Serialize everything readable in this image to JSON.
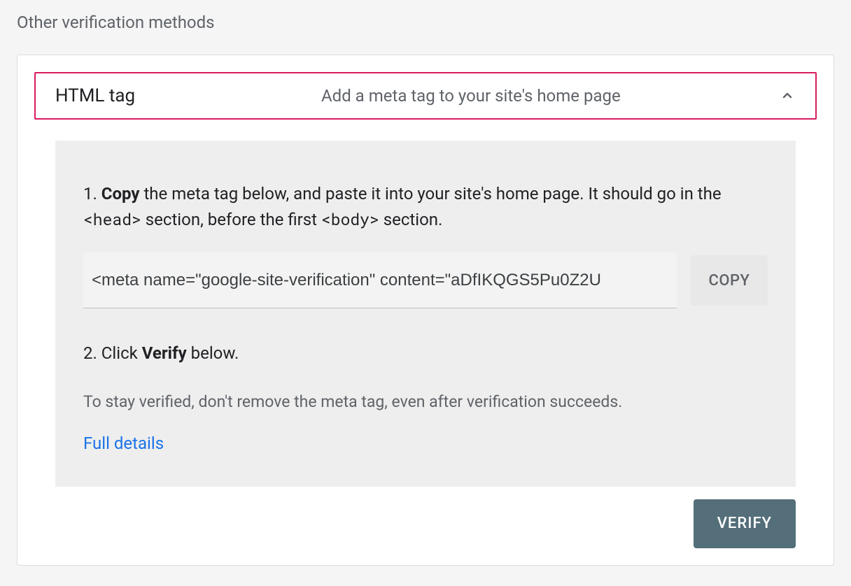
{
  "section_title": "Other verification methods",
  "method": {
    "title": "HTML tag",
    "subtitle": "Add a meta tag to your site's home page"
  },
  "step1": {
    "prefix": "1. ",
    "bold": "Copy",
    "mid1": " the meta tag below, and paste it into your site's home page. It should go in the ",
    "code1": "<head>",
    "mid2": " section, before the first ",
    "code2": "<body>",
    "suffix": " section."
  },
  "meta_tag_value": "<meta name=\"google-site-verification\" content=\"aDfIKQGS5Pu0Z2U",
  "copy_button": "COPY",
  "step2": {
    "prefix": "2. Click ",
    "bold": "Verify",
    "suffix": " below."
  },
  "note": "To stay verified, don't remove the meta tag, even after verification succeeds.",
  "full_details": "Full details",
  "verify_button": "VERIFY"
}
